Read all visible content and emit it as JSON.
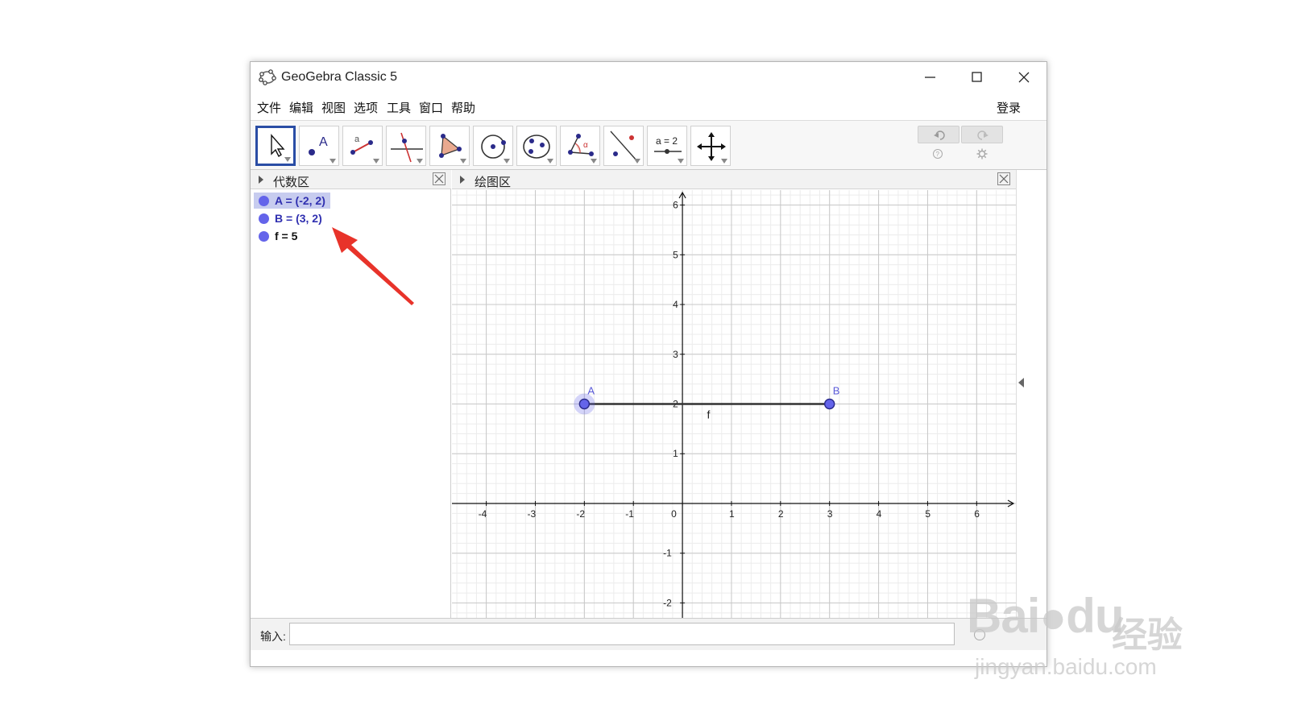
{
  "window": {
    "title": "GeoGebra Classic 5"
  },
  "menu": {
    "items": [
      "文件",
      "编辑",
      "视图",
      "选项",
      "工具",
      "窗口",
      "帮助"
    ],
    "login": "登录"
  },
  "toolbar": {
    "tools": [
      "move-tool",
      "point-tool",
      "segment-tool",
      "perpendicular-line-tool",
      "polygon-tool",
      "circle-center-point-tool",
      "conic-tool",
      "angle-tool",
      "reflect-tool",
      "slider-tool",
      "move-graphics-view-tool"
    ],
    "slider_label": "a = 2",
    "selected_tool": "move-tool"
  },
  "algebra_view": {
    "title": "代数区",
    "items": [
      {
        "text": "A = (-2, 2)",
        "selected": true
      },
      {
        "text": "B = (3, 2)",
        "selected": false
      },
      {
        "text": "f = 5",
        "selected": false
      }
    ]
  },
  "graphics_view": {
    "title": "绘图区",
    "x_range": [
      -4.7,
      6.8
    ],
    "y_range": [
      -2.3,
      6.3
    ],
    "x_ticks": [
      "-4",
      "-3",
      "-2",
      "-1",
      "0",
      "1",
      "2",
      "3",
      "4",
      "5",
      "6"
    ],
    "y_ticks": [
      "6",
      "5",
      "4",
      "3",
      "2",
      "1",
      "-1",
      "-2"
    ],
    "points": [
      {
        "name": "A",
        "x": -2,
        "y": 2,
        "selected": true
      },
      {
        "name": "B",
        "x": 3,
        "y": 2,
        "selected": false
      }
    ],
    "segment": {
      "name": "f",
      "from": "A",
      "to": "B"
    },
    "grid": true,
    "colors": {
      "point": "#6464ea",
      "point_stroke": "#2a2a8a",
      "segment": "#333333",
      "label": "#5a5ad8"
    }
  },
  "input_bar": {
    "label": "输入:",
    "value": ""
  },
  "watermark": {
    "brand": "Bai",
    "brand2": "du",
    "jingyan": "经验",
    "url": "jingyan.baidu.com"
  },
  "annotation": {
    "color": "#e8332a"
  }
}
